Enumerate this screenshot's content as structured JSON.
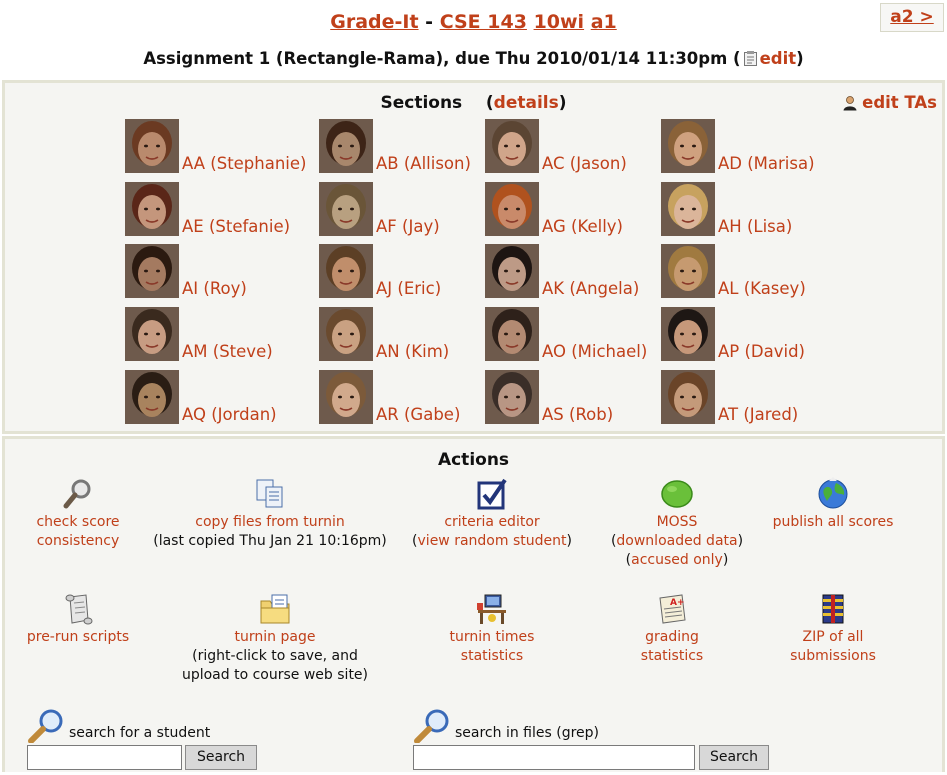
{
  "header": {
    "app_name": "Grade-It",
    "separator": "-",
    "course": "CSE 143",
    "quarter": "10wi",
    "assignment_code": "a1",
    "assignment_line": "Assignment 1 (Rectangle-Rama), due Thu 2010/01/14 11:30pm (",
    "edit_label": "edit",
    "close_paren": ")",
    "next_link": "a2 >"
  },
  "sections": {
    "title": "Sections",
    "details_open": "(",
    "details_label": "details",
    "details_close": ")",
    "edit_tas_label": "edit TAs",
    "tas": [
      {
        "label": "AA (Stephanie)",
        "photo_color": "#b98a6d",
        "hair": "#6b3a22"
      },
      {
        "label": "AB (Allison)",
        "photo_color": "#a8876c",
        "hair": "#3d2417"
      },
      {
        "label": "AC (Jason)",
        "photo_color": "#d0a58a",
        "hair": "#5b4533"
      },
      {
        "label": "AD (Marisa)",
        "photo_color": "#cfa17f",
        "hair": "#8a6238"
      },
      {
        "label": "AE (Stefanie)",
        "photo_color": "#c4967c",
        "hair": "#5a2618"
      },
      {
        "label": "AF (Jay)",
        "photo_color": "#b8a080",
        "hair": "#6a5538"
      },
      {
        "label": "AG (Kelly)",
        "photo_color": "#c98a6a",
        "hair": "#b0521e"
      },
      {
        "label": "AH (Lisa)",
        "photo_color": "#dbb59a",
        "hair": "#c7a25f"
      },
      {
        "label": "AI (Roy)",
        "photo_color": "#a47a60",
        "hair": "#2b1a10"
      },
      {
        "label": "AJ (Eric)",
        "photo_color": "#c08e6b",
        "hair": "#5c3f25"
      },
      {
        "label": "AK (Angela)",
        "photo_color": "#bd9a86",
        "hair": "#1d1512"
      },
      {
        "label": "AL (Kasey)",
        "photo_color": "#c69a70",
        "hair": "#a07a40"
      },
      {
        "label": "AM (Steve)",
        "photo_color": "#c79c82",
        "hair": "#3a2a1e"
      },
      {
        "label": "AN (Kim)",
        "photo_color": "#c9a182",
        "hair": "#6a4a2e"
      },
      {
        "label": "AO (Michael)",
        "photo_color": "#b38a72",
        "hair": "#2e211a"
      },
      {
        "label": "AP (David)",
        "photo_color": "#c6987a",
        "hair": "#1e1714"
      },
      {
        "label": "AQ (Jordan)",
        "photo_color": "#a8835e",
        "hair": "#2a1d14"
      },
      {
        "label": "AR (Gabe)",
        "photo_color": "#d1a98c",
        "hair": "#7c5a3a"
      },
      {
        "label": "AS (Rob)",
        "photo_color": "#b89684",
        "hair": "#3a2e28"
      },
      {
        "label": "AT (Jared)",
        "photo_color": "#c49a7a",
        "hair": "#6a4428"
      }
    ]
  },
  "actions": {
    "title": "Actions",
    "items": [
      {
        "label_lines": [
          "check score",
          "consistency"
        ],
        "icon": "magnifier-icon"
      },
      {
        "label_lines": [
          "copy files from turnin"
        ],
        "plain": "(last copied Thu Jan 21 10:16pm)",
        "icon": "copy-files-icon"
      },
      {
        "label_lines": [
          "criteria editor"
        ],
        "sub_prefix": "(",
        "sub_link": "view random student",
        "sub_suffix": ")",
        "icon": "checkbox-icon"
      },
      {
        "label_lines": [
          "MOSS"
        ],
        "moss_a_prefix": "(",
        "moss_a": "downloaded data",
        "moss_a_suffix": ")",
        "moss_b_prefix": "(",
        "moss_b": "accused only",
        "moss_b_suffix": ")",
        "icon": "green-blob-icon"
      },
      {
        "label_lines": [
          "publish all scores"
        ],
        "icon": "globe-icon"
      },
      {
        "label_lines": [
          "pre-run scripts"
        ],
        "icon": "scroll-icon"
      },
      {
        "label_lines": [
          "turnin page"
        ],
        "plain_lines": [
          "(right-click to save, and",
          "upload to course web site)"
        ],
        "icon": "folder-page-icon"
      },
      {
        "label_lines": [
          "turnin times",
          "statistics"
        ],
        "icon": "desk-computer-icon"
      },
      {
        "label_lines": [
          "grading",
          "statistics"
        ],
        "icon": "graded-paper-icon"
      },
      {
        "label_lines": [
          "ZIP of all",
          "submissions"
        ],
        "icon": "zip-archive-icon"
      }
    ]
  },
  "search": {
    "student_label": "search for a student",
    "student_value": "",
    "files_label": "search in files (grep)",
    "files_value": "",
    "button_label": "Search"
  }
}
